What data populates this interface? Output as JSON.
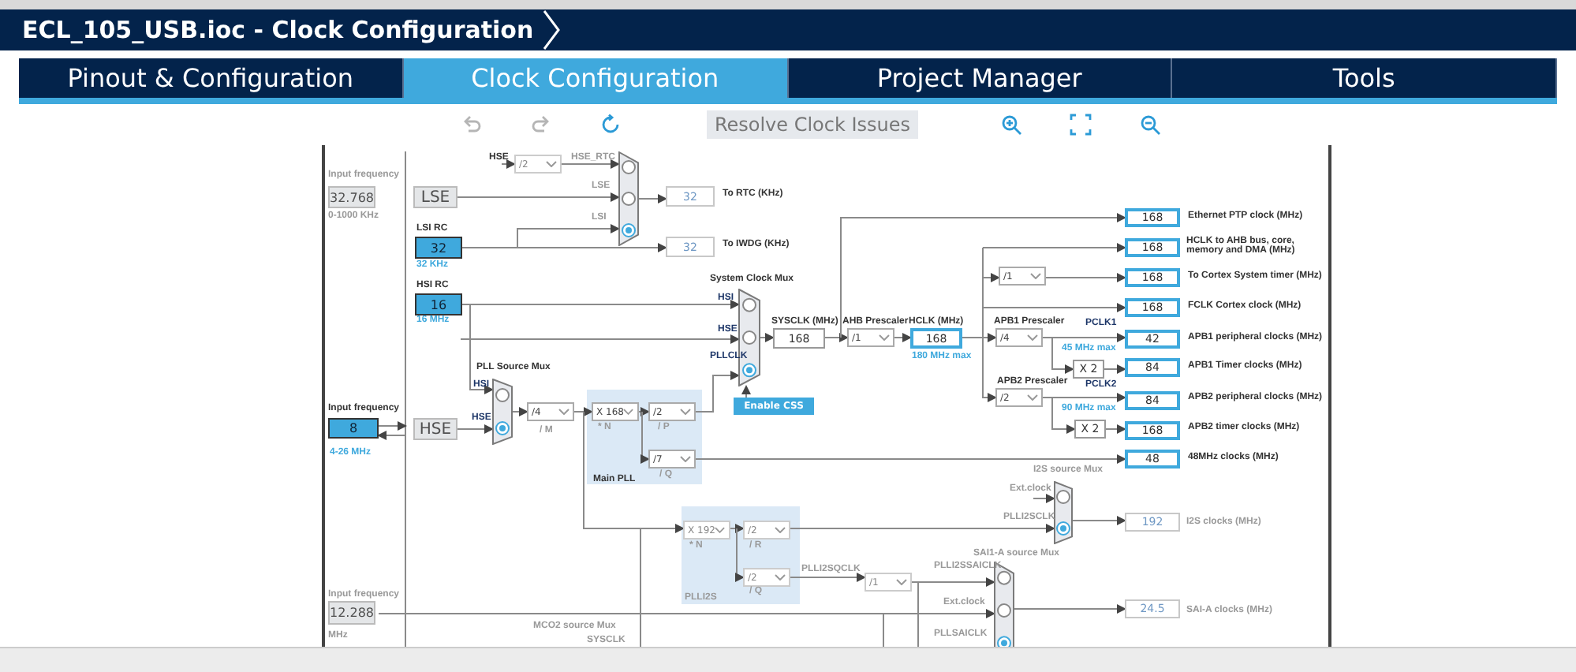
{
  "window": {
    "title": "ECL_105_USB.ioc - Clock Configuration"
  },
  "tabs": [
    {
      "label": "Pinout & Configuration",
      "selected": false
    },
    {
      "label": "Clock Configuration",
      "selected": true
    },
    {
      "label": "Project Manager",
      "selected": false
    },
    {
      "label": "Tools",
      "selected": false
    }
  ],
  "toolbar": [
    {
      "kind": "undo",
      "disabled": true
    },
    {
      "kind": "redo",
      "disabled": true
    },
    {
      "kind": "refresh",
      "disabled": false
    },
    {
      "kind": "text",
      "label": "Resolve Clock Issues",
      "disabled": true
    },
    {
      "kind": "zoom-in",
      "disabled": false
    },
    {
      "kind": "fit",
      "disabled": false
    },
    {
      "kind": "zoom-out",
      "disabled": false
    }
  ],
  "diagram": {
    "labels": [
      {
        "text": "Input frequency",
        "kind": "muted"
      },
      {
        "text": "0-1000 KHz",
        "kind": "muted"
      },
      {
        "text": "HSE",
        "kind": "dark"
      },
      {
        "text": "HSE_RTC",
        "kind": "muted"
      },
      {
        "text": "LSE",
        "kind": "muted"
      },
      {
        "text": "LSI",
        "kind": "muted"
      },
      {
        "text": "To RTC (KHz)",
        "kind": "dark"
      },
      {
        "text": "LSI RC",
        "kind": "dark"
      },
      {
        "text": "To IWDG (KHz)",
        "kind": "dark"
      },
      {
        "text": "32 KHz",
        "kind": "blue"
      },
      {
        "text": "System Clock Mux",
        "kind": "dark"
      },
      {
        "text": "HSI RC",
        "kind": "dark"
      },
      {
        "text": "HSI",
        "kind": "navy"
      },
      {
        "text": "16 MHz",
        "kind": "blue"
      },
      {
        "text": "SYSCLK (MHz)",
        "kind": "dark"
      },
      {
        "text": "AHB Prescaler",
        "kind": "dark"
      },
      {
        "text": "HCLK (MHz)",
        "kind": "dark"
      },
      {
        "text": "APB1 Prescaler",
        "kind": "dark"
      },
      {
        "text": "PCLK1",
        "kind": "navy"
      },
      {
        "text": "HSE",
        "kind": "navy"
      },
      {
        "text": "45 MHz max",
        "kind": "blue"
      },
      {
        "text": "180 MHz max",
        "kind": "blue"
      },
      {
        "text": "PLLCLK",
        "kind": "navy"
      },
      {
        "text": "PLL Source Mux",
        "kind": "dark"
      },
      {
        "text": "APB2 Prescaler",
        "kind": "dark"
      },
      {
        "text": "HSI",
        "kind": "navy"
      },
      {
        "text": "PCLK2",
        "kind": "navy"
      },
      {
        "text": "90 MHz max",
        "kind": "blue"
      },
      {
        "text": "Input frequency",
        "kind": "dark"
      },
      {
        "text": "HSE",
        "kind": "navy"
      },
      {
        "text": "* N",
        "kind": "muted"
      },
      {
        "text": "/ P",
        "kind": "muted"
      },
      {
        "text": "/ M",
        "kind": "muted"
      },
      {
        "text": "4-26 MHz",
        "kind": "blue"
      },
      {
        "text": "I2S source Mux",
        "kind": "muted"
      },
      {
        "text": "/ Q",
        "kind": "muted"
      },
      {
        "text": "Main PLL",
        "kind": "dark"
      },
      {
        "text": "Ext.clock",
        "kind": "muted"
      },
      {
        "text": "PLLI2SCLK",
        "kind": "muted"
      },
      {
        "text": "* N",
        "kind": "muted"
      },
      {
        "text": "/ R",
        "kind": "muted"
      },
      {
        "text": "SAI1-A source Mux",
        "kind": "muted"
      },
      {
        "text": "PLLI2SQCLK",
        "kind": "muted"
      },
      {
        "text": "PLLI2SSAICLK",
        "kind": "muted"
      },
      {
        "text": "/ Q",
        "kind": "muted"
      },
      {
        "text": "Input frequency",
        "kind": "muted"
      },
      {
        "text": "PLLI2S",
        "kind": "muted"
      },
      {
        "text": "Ext.clock",
        "kind": "muted"
      },
      {
        "text": "MCO2 source Mux",
        "kind": "muted"
      },
      {
        "text": "PLLSAICLK",
        "kind": "muted"
      },
      {
        "text": "MHz",
        "kind": "muted"
      },
      {
        "text": "SYSCLK",
        "kind": "muted"
      },
      {
        "text": "Ethernet PTP clock (MHz)",
        "kind": "dark"
      },
      {
        "text": "HCLK to AHB bus, core, memory and DMA (MHz)",
        "kind": "dark"
      },
      {
        "text": "To Cortex System timer (MHz)",
        "kind": "dark"
      },
      {
        "text": "FCLK Cortex clock (MHz)",
        "kind": "dark"
      },
      {
        "text": "APB1 peripheral clocks (MHz)",
        "kind": "dark"
      },
      {
        "text": "APB1 Timer clocks (MHz)",
        "kind": "dark"
      },
      {
        "text": "APB2 peripheral clocks (MHz)",
        "kind": "dark"
      },
      {
        "text": "APB2 timer clocks (MHz)",
        "kind": "dark"
      },
      {
        "text": "48MHz clocks (MHz)",
        "kind": "dark"
      },
      {
        "text": "I2S clocks (MHz)",
        "kind": "muted"
      },
      {
        "text": "SAI-A clocks (MHz)",
        "kind": "muted"
      }
    ],
    "boxes": [
      {
        "value": "32.768",
        "kind": "input",
        "active": false
      },
      {
        "value": "LSE",
        "kind": "source",
        "active": false
      },
      {
        "value": "32",
        "kind": "output",
        "active": false
      },
      {
        "value": "32",
        "kind": "source",
        "active": true
      },
      {
        "value": "32",
        "kind": "output",
        "active": false
      },
      {
        "value": "16",
        "kind": "source",
        "active": true
      },
      {
        "value": "168",
        "kind": "value",
        "active": true
      },
      {
        "value": "168",
        "kind": "output",
        "active": true
      },
      {
        "value": "168",
        "kind": "output",
        "active": true
      },
      {
        "value": "168",
        "kind": "output",
        "active": true
      },
      {
        "value": "168",
        "kind": "output",
        "active": true
      },
      {
        "value": "168",
        "kind": "output",
        "active": true
      },
      {
        "value": "42",
        "kind": "output",
        "active": true
      },
      {
        "value": "84",
        "kind": "output",
        "active": true
      },
      {
        "value": "84",
        "kind": "output",
        "active": true
      },
      {
        "value": "168",
        "kind": "output",
        "active": true
      },
      {
        "value": "48",
        "kind": "output",
        "active": true
      },
      {
        "value": "8",
        "kind": "input",
        "active": true
      },
      {
        "value": "HSE",
        "kind": "source",
        "active": false
      },
      {
        "value": "X 2",
        "kind": "value",
        "active": true
      },
      {
        "value": "X 2",
        "kind": "value",
        "active": true
      },
      {
        "value": "12.288",
        "kind": "input",
        "active": false
      },
      {
        "value": "192",
        "kind": "output",
        "active": false
      },
      {
        "value": "24.5",
        "kind": "output",
        "active": false
      },
      {
        "value": "Enable CSS",
        "kind": "button",
        "active": true
      }
    ],
    "dropdowns": [
      {
        "value": "/2",
        "active": false
      },
      {
        "value": "/1",
        "active": true
      },
      {
        "value": "/1",
        "active": true
      },
      {
        "value": "/4",
        "active": true
      },
      {
        "value": "/2",
        "active": true
      },
      {
        "value": "/4",
        "active": true
      },
      {
        "value": "X 168",
        "active": true
      },
      {
        "value": "/2",
        "active": true
      },
      {
        "value": "/7",
        "active": true
      },
      {
        "value": "X 192",
        "active": false
      },
      {
        "value": "/2",
        "active": false
      },
      {
        "value": "/2",
        "active": false
      },
      {
        "value": "/1",
        "active": false
      }
    ],
    "muxes": [
      {
        "options": [
          {
            "selected": false
          },
          {
            "selected": false
          },
          {
            "selected": true
          }
        ]
      },
      {
        "options": [
          {
            "selected": false
          },
          {
            "selected": false
          },
          {
            "selected": true
          }
        ]
      },
      {
        "options": [
          {
            "selected": false
          },
          {
            "selected": true
          }
        ]
      },
      {
        "options": [
          {
            "selected": false
          },
          {
            "selected": true
          }
        ]
      },
      {
        "options": [
          {
            "selected": false
          },
          {
            "selected": false
          },
          {
            "selected": true
          }
        ]
      }
    ]
  }
}
